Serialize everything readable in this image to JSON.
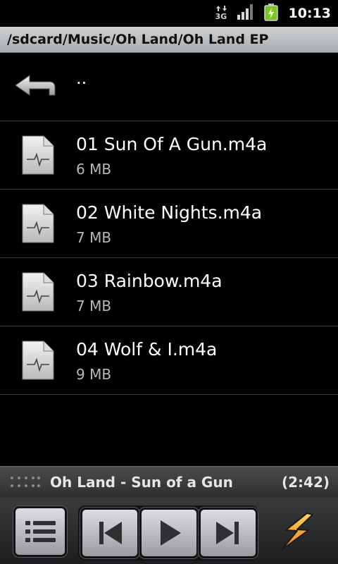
{
  "status_bar": {
    "time": "10:13",
    "network_label": "3G",
    "icons": [
      "data-activity-icon",
      "signal-icon",
      "battery-charging-icon"
    ],
    "colors": {
      "battery": "#79c61f"
    }
  },
  "path_bar": {
    "path": "/sdcard/Music/Oh Land/Oh Land EP"
  },
  "file_list": {
    "parent_label": "..",
    "items": [
      {
        "name": "01 Sun Of A Gun.m4a",
        "size": "6 MB"
      },
      {
        "name": "02 White Nights.m4a",
        "size": "7 MB"
      },
      {
        "name": "03 Rainbow.m4a",
        "size": "7 MB"
      },
      {
        "name": "04 Wolf & I.m4a",
        "size": "9 MB"
      }
    ]
  },
  "now_playing": {
    "title": "Oh Land - Sun of a Gun",
    "duration": "(2:42)"
  },
  "controls": {
    "buttons": [
      "playlist-icon",
      "previous-icon",
      "play-icon",
      "next-icon",
      "winamp-bolt-icon"
    ],
    "colors": {
      "bolt": "#f2a31b"
    }
  }
}
